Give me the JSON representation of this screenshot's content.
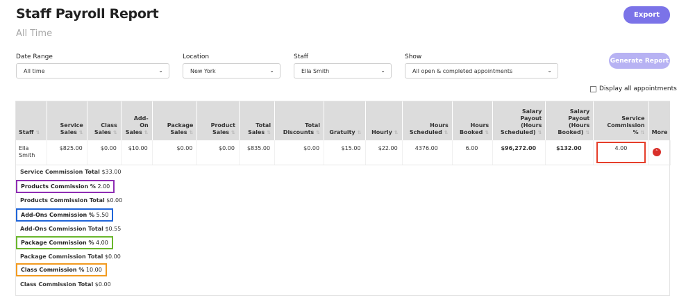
{
  "header": {
    "title": "Staff Payroll Report",
    "subtitle": "All Time",
    "export_label": "Export"
  },
  "filters": {
    "date_range": {
      "label": "Date Range",
      "value": "All time"
    },
    "location": {
      "label": "Location",
      "value": "New York"
    },
    "staff": {
      "label": "Staff",
      "value": "Ella Smith"
    },
    "show": {
      "label": "Show",
      "value": "All open & completed appointments"
    },
    "generate_label": "Generate Report",
    "display_all_label": "Display all appointments"
  },
  "table": {
    "columns": {
      "staff": "Staff",
      "service_sales": [
        "Service",
        "Sales"
      ],
      "class_sales": [
        "Class",
        "Sales"
      ],
      "addon_sales": [
        "Add-",
        "On",
        "Sales"
      ],
      "package_sales": [
        "Package",
        "Sales"
      ],
      "product_sales": [
        "Product",
        "Sales"
      ],
      "total_sales": [
        "Total",
        "Sales"
      ],
      "total_discounts": [
        "Total",
        "Discounts"
      ],
      "gratuity": "Gratuity",
      "hourly": "Hourly",
      "hours_scheduled": [
        "Hours",
        "Scheduled"
      ],
      "hours_booked": [
        "Hours",
        "Booked"
      ],
      "salary_scheduled": [
        "Salary",
        "Payout",
        "(Hours",
        "Scheduled)"
      ],
      "salary_booked": [
        "Salary",
        "Payout",
        "(Hours",
        "Booked)"
      ],
      "service_commission": [
        "Service",
        "Commission",
        "%"
      ],
      "more": "More"
    },
    "row": {
      "staff": [
        "Ella",
        "Smith"
      ],
      "service_sales": "$825.00",
      "class_sales": "$0.00",
      "addon_sales": "$10.00",
      "package_sales": "$0.00",
      "product_sales": "$0.00",
      "total_sales": "$835.00",
      "total_discounts": "$0.00",
      "gratuity": "$15.00",
      "hourly": "$22.00",
      "hours_scheduled": "4376.00",
      "hours_booked": "6.00",
      "salary_scheduled": "$96,272.00",
      "salary_booked": "$132.00",
      "service_commission": "4.00"
    }
  },
  "details": [
    {
      "label": "Service Commission Total",
      "value": "$33.00",
      "highlight": null
    },
    {
      "label": "Products Commission %",
      "value": "2.00",
      "highlight": "#8e2db3"
    },
    {
      "label": "Products Commission Total",
      "value": "$0.00",
      "highlight": null
    },
    {
      "label": "Add-Ons Commission %",
      "value": "5.50",
      "highlight": "#1f64d8"
    },
    {
      "label": "Add-Ons Commission Total",
      "value": "$0.55",
      "highlight": null
    },
    {
      "label": "Package Commission %",
      "value": "4.00",
      "highlight": "#6ab62c"
    },
    {
      "label": "Package Commission Total",
      "value": "$0.00",
      "highlight": null
    },
    {
      "label": "Class Commission %",
      "value": "10.00",
      "highlight": "#f29a1f"
    },
    {
      "label": "Class Commission Total",
      "value": "$0.00",
      "highlight": null
    }
  ],
  "colors": {
    "accent": "#7b73e8",
    "accent_disabled": "#b7b2f3",
    "commission_highlight": "#e53e2a",
    "more_button": "#d9302a"
  }
}
